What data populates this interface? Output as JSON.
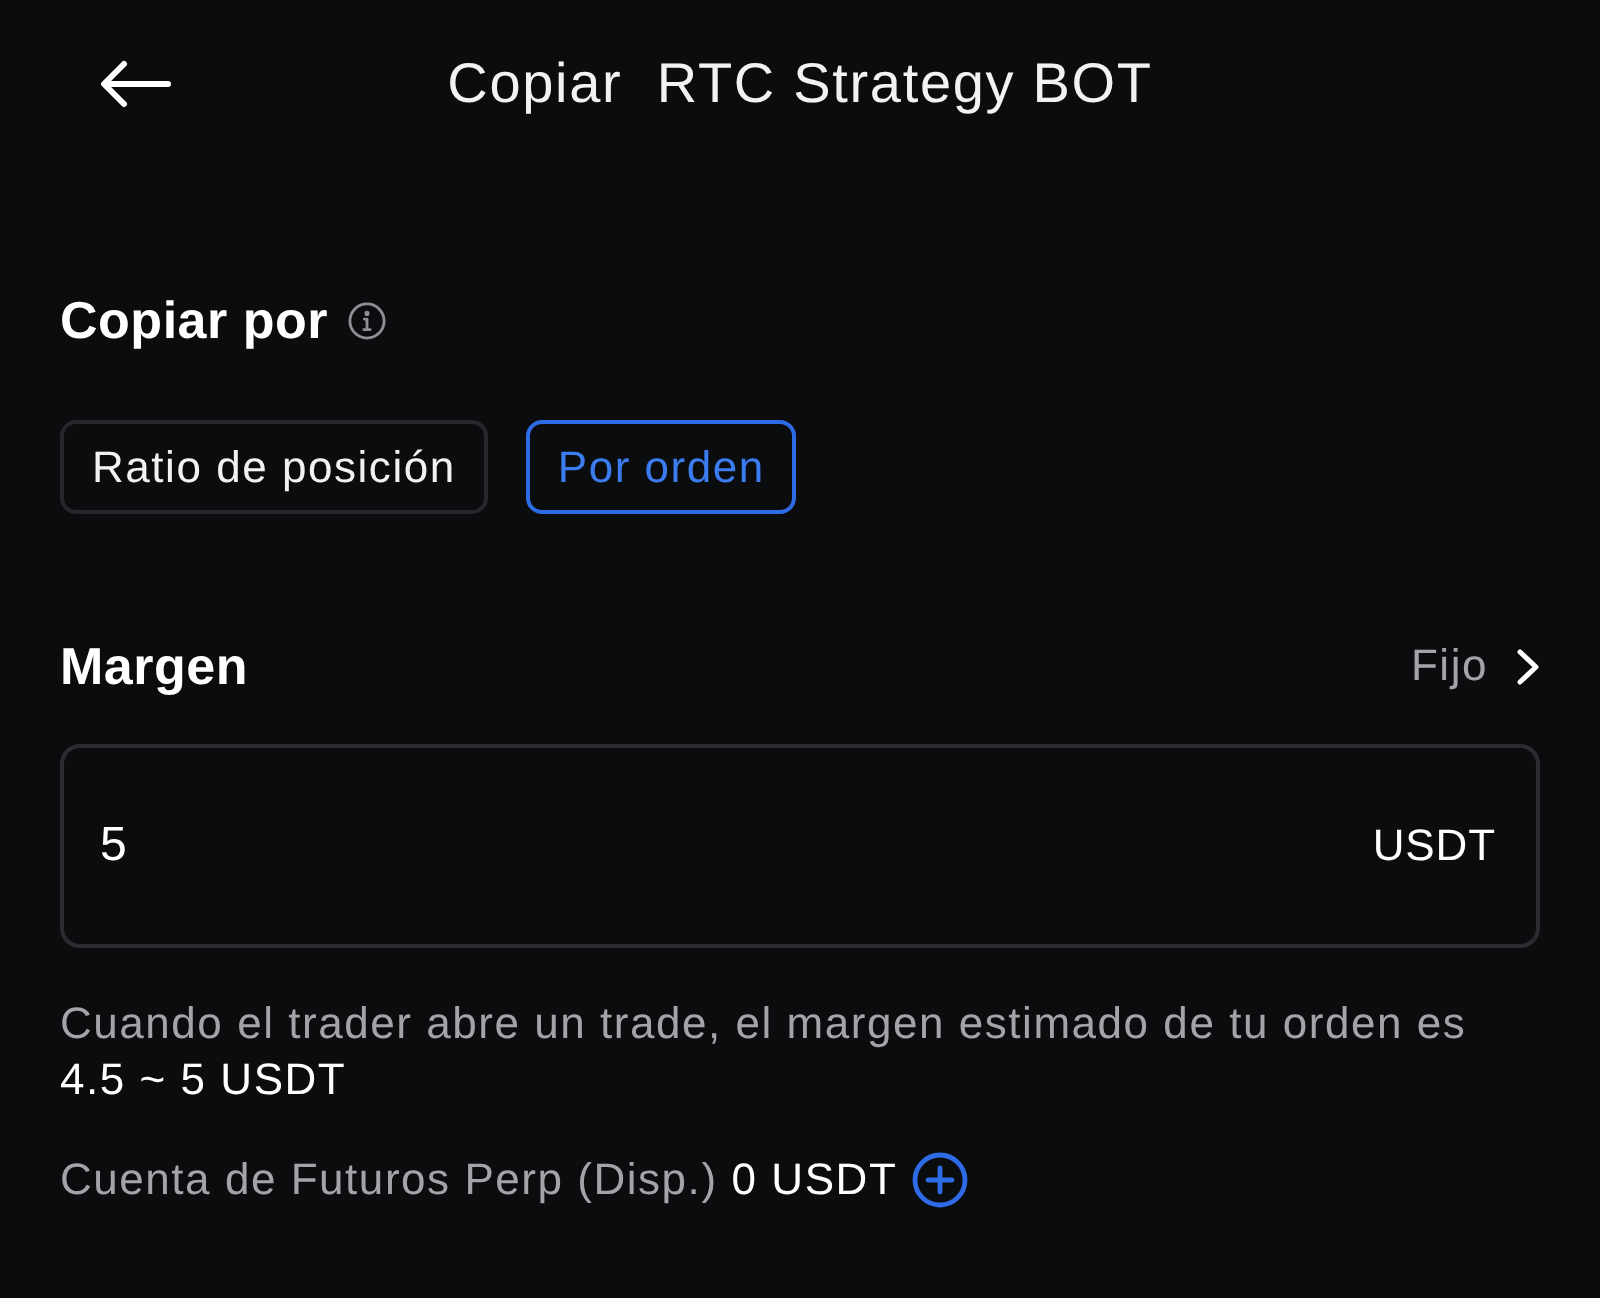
{
  "header": {
    "title": "Copiar  RTC Strategy BOT"
  },
  "copy_by": {
    "label": "Copiar por",
    "options": [
      {
        "label": "Ratio de posición",
        "selected": false
      },
      {
        "label": "Por orden",
        "selected": true
      }
    ]
  },
  "margin": {
    "label": "Margen",
    "mode": "Fijo",
    "input": {
      "value": "5",
      "unit": "USDT"
    },
    "hint": "Cuando el trader abre un trade, el margen estimado de tu orden es",
    "estimate": "4.5 ~ 5 USDT"
  },
  "account": {
    "label": "Cuenta de Futuros Perp (Disp.)",
    "balance": "0 USDT"
  }
}
